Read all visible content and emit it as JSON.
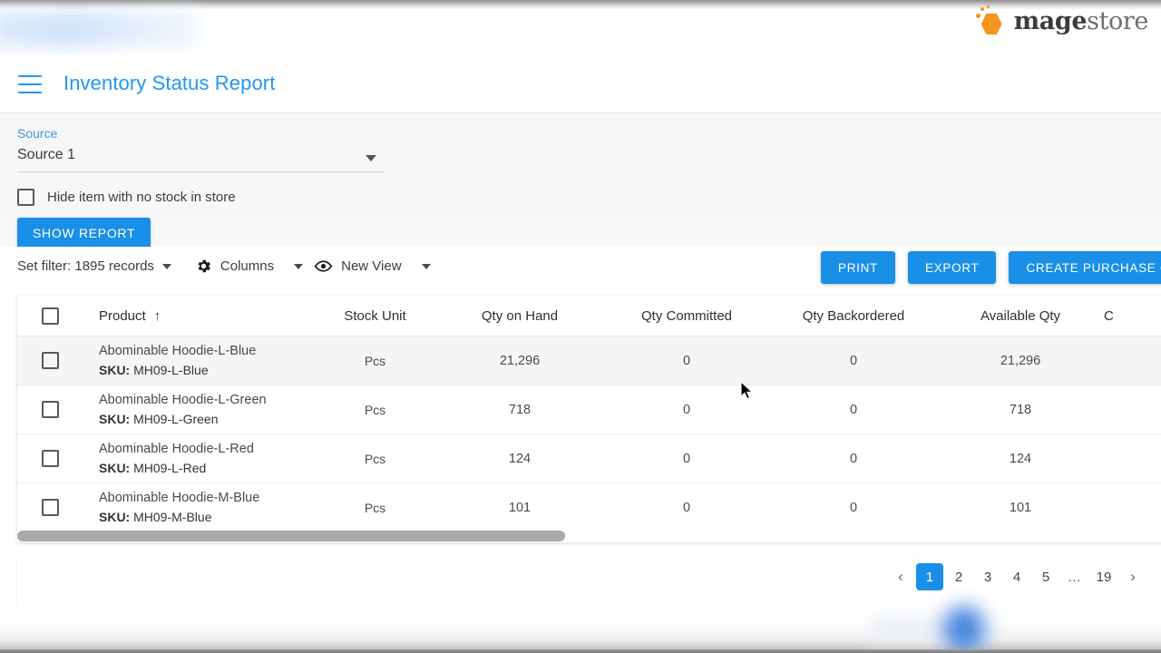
{
  "brand": {
    "logo_text_bold": "mage",
    "logo_text_light": "store",
    "logo_color": "#f7941e"
  },
  "header": {
    "menu_icon": "hamburger-menu-icon",
    "title": "Inventory Status Report",
    "title_color": "#2196f3"
  },
  "filter_panel": {
    "source_label": "Source",
    "source_value": "Source 1",
    "source_options": [
      "Source 1"
    ],
    "hide_no_stock_label": "Hide item with no stock in store",
    "hide_no_stock_checked": false,
    "show_report_label": "SHOW REPORT"
  },
  "toolbar": {
    "set_filter_label": "Set filter: 1895 records",
    "columns_label": "Columns",
    "columns_icon": "gear-icon",
    "new_view_label": "New View",
    "new_view_icon": "eye-icon",
    "print_label": "PRINT",
    "export_label": "EXPORT",
    "create_po_label": "CREATE PURCHASE ORDER",
    "button_color": "#1a8fe8"
  },
  "table": {
    "select_all_checked": false,
    "sort_column": "Product",
    "sort_direction": "asc",
    "sort_indicator": "↑",
    "columns": [
      "Product",
      "Stock Unit",
      "Qty on Hand",
      "Qty Committed",
      "Qty Backordered",
      "Available Qty",
      "C"
    ],
    "rows": [
      {
        "selected": false,
        "hovered": true,
        "product": "Abominable Hoodie-L-Blue",
        "sku_label": "SKU:",
        "sku": "MH09-L-Blue",
        "stock_unit": "Pcs",
        "qty_on_hand": "21,296",
        "qty_committed": "0",
        "qty_backordered": "0",
        "available_qty": "21,296"
      },
      {
        "selected": false,
        "hovered": false,
        "product": "Abominable Hoodie-L-Green",
        "sku_label": "SKU:",
        "sku": "MH09-L-Green",
        "stock_unit": "Pcs",
        "qty_on_hand": "718",
        "qty_committed": "0",
        "qty_backordered": "0",
        "available_qty": "718"
      },
      {
        "selected": false,
        "hovered": false,
        "product": "Abominable Hoodie-L-Red",
        "sku_label": "SKU:",
        "sku": "MH09-L-Red",
        "stock_unit": "Pcs",
        "qty_on_hand": "124",
        "qty_committed": "0",
        "qty_backordered": "0",
        "available_qty": "124"
      },
      {
        "selected": false,
        "hovered": false,
        "product": "Abominable Hoodie-M-Blue",
        "sku_label": "SKU:",
        "sku": "MH09-M-Blue",
        "stock_unit": "Pcs",
        "qty_on_hand": "101",
        "qty_committed": "0",
        "qty_backordered": "0",
        "available_qty": "101"
      }
    ]
  },
  "pagination": {
    "prev_icon": "‹",
    "next_icon": "›",
    "pages": [
      "1",
      "2",
      "3",
      "4",
      "5",
      "…",
      "19"
    ],
    "current_page": "1",
    "active_color": "#1a8fe8"
  }
}
